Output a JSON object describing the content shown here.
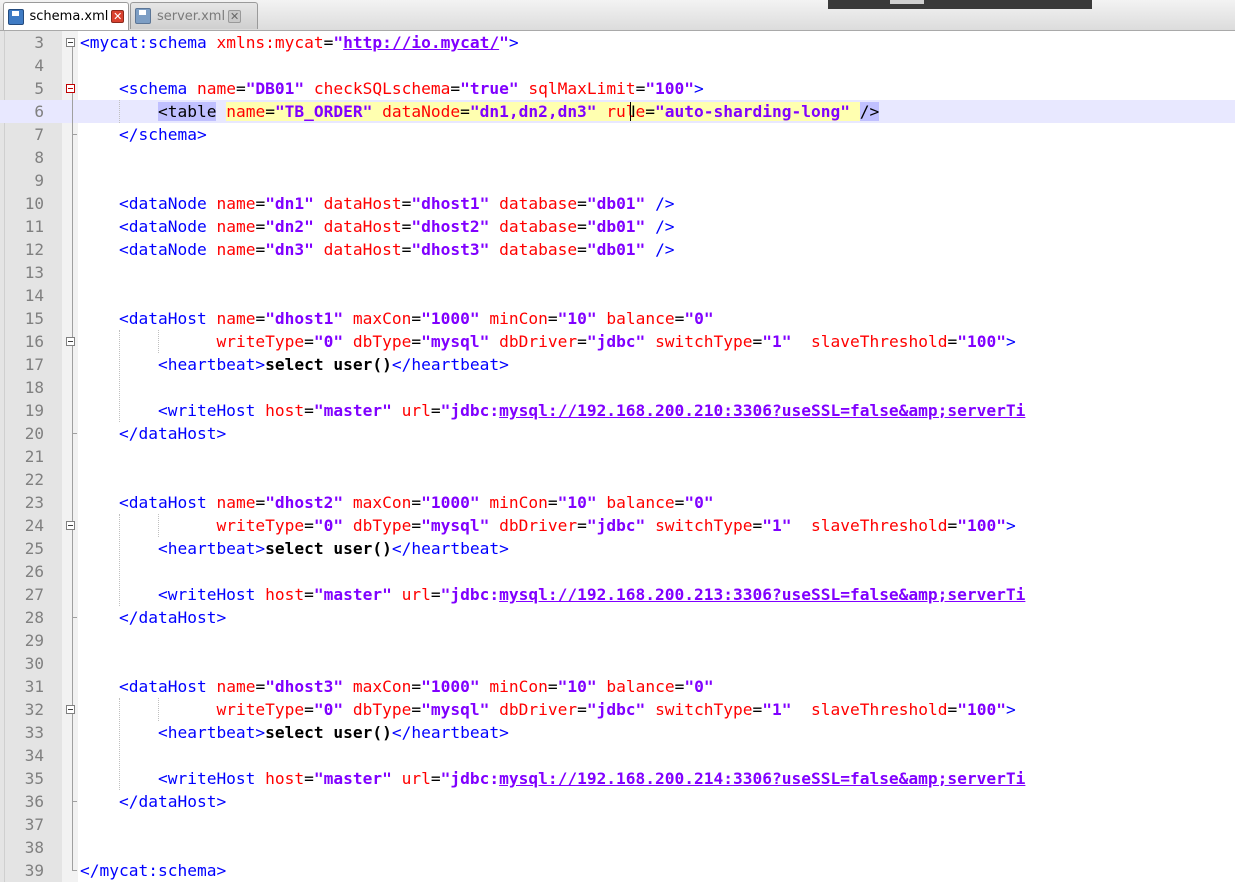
{
  "tabs": [
    {
      "label": "schema.xml",
      "active": true,
      "icon": "save-disk-icon"
    },
    {
      "label": "server.xml",
      "active": false,
      "icon": "save-disk-icon"
    }
  ],
  "tab_close_glyph": "✕",
  "editor": {
    "current_line": 6,
    "colors": {
      "tag": "#0000ff",
      "attribute": "#ff0000",
      "value": "#8000ff",
      "line_number": "#808080",
      "current_line_bg": "#e8e8ff"
    },
    "lines": [
      {
        "n": 3,
        "tokens": [
          [
            "tg",
            "<mycat:schema "
          ],
          [
            "at",
            "xmlns:mycat"
          ],
          [
            "eq",
            "="
          ],
          [
            "vl",
            "\""
          ],
          [
            "lk",
            "http://io.mycat/"
          ],
          [
            "vl",
            "\""
          ],
          [
            "tg",
            ">"
          ]
        ]
      },
      {
        "n": 4,
        "tokens": []
      },
      {
        "n": 5,
        "tokens": [
          [
            "tg",
            "    <schema "
          ],
          [
            "at",
            "name"
          ],
          [
            "eq",
            "="
          ],
          [
            "vl",
            "\"DB01\" "
          ],
          [
            "at",
            "checkSQLschema"
          ],
          [
            "eq",
            "="
          ],
          [
            "vl",
            "\"true\" "
          ],
          [
            "at",
            "sqlMaxLimit"
          ],
          [
            "eq",
            "="
          ],
          [
            "vl",
            "\"100\""
          ],
          [
            "tg",
            ">"
          ]
        ]
      },
      {
        "n": 6,
        "tokens": [
          [
            "tg",
            "        "
          ],
          [
            "tsel",
            "<table"
          ],
          [
            "tg",
            " "
          ],
          [
            "at hl",
            "name"
          ],
          [
            "eq hl",
            "="
          ],
          [
            "vl hl",
            "\"TB_ORDER\" "
          ],
          [
            "at hl",
            "dataNode"
          ],
          [
            "eq hl",
            "="
          ],
          [
            "vl hl",
            "\"dn1,dn2,dn3\" "
          ],
          [
            "at hl",
            "rule"
          ],
          [
            "eq hl",
            "="
          ],
          [
            "vl hl",
            "\"auto-sharding-long\" "
          ],
          [
            "tsel",
            "/>"
          ]
        ]
      },
      {
        "n": 7,
        "tokens": [
          [
            "tg",
            "    </schema>"
          ]
        ]
      },
      {
        "n": 8,
        "tokens": []
      },
      {
        "n": 9,
        "tokens": []
      },
      {
        "n": 10,
        "tokens": [
          [
            "tg",
            "    <dataNode "
          ],
          [
            "at",
            "name"
          ],
          [
            "eq",
            "="
          ],
          [
            "vl",
            "\"dn1\" "
          ],
          [
            "at",
            "dataHost"
          ],
          [
            "eq",
            "="
          ],
          [
            "vl",
            "\"dhost1\" "
          ],
          [
            "at",
            "database"
          ],
          [
            "eq",
            "="
          ],
          [
            "vl",
            "\"db01\" "
          ],
          [
            "tg",
            "/>"
          ]
        ]
      },
      {
        "n": 11,
        "tokens": [
          [
            "tg",
            "    <dataNode "
          ],
          [
            "at",
            "name"
          ],
          [
            "eq",
            "="
          ],
          [
            "vl",
            "\"dn2\" "
          ],
          [
            "at",
            "dataHost"
          ],
          [
            "eq",
            "="
          ],
          [
            "vl",
            "\"dhost2\" "
          ],
          [
            "at",
            "database"
          ],
          [
            "eq",
            "="
          ],
          [
            "vl",
            "\"db01\" "
          ],
          [
            "tg",
            "/>"
          ]
        ]
      },
      {
        "n": 12,
        "tokens": [
          [
            "tg",
            "    <dataNode "
          ],
          [
            "at",
            "name"
          ],
          [
            "eq",
            "="
          ],
          [
            "vl",
            "\"dn3\" "
          ],
          [
            "at",
            "dataHost"
          ],
          [
            "eq",
            "="
          ],
          [
            "vl",
            "\"dhost3\" "
          ],
          [
            "at",
            "database"
          ],
          [
            "eq",
            "="
          ],
          [
            "vl",
            "\"db01\" "
          ],
          [
            "tg",
            "/>"
          ]
        ]
      },
      {
        "n": 13,
        "tokens": []
      },
      {
        "n": 14,
        "tokens": []
      },
      {
        "n": 15,
        "tokens": [
          [
            "tg",
            "    <dataHost "
          ],
          [
            "at",
            "name"
          ],
          [
            "eq",
            "="
          ],
          [
            "vl",
            "\"dhost1\" "
          ],
          [
            "at",
            "maxCon"
          ],
          [
            "eq",
            "="
          ],
          [
            "vl",
            "\"1000\" "
          ],
          [
            "at",
            "minCon"
          ],
          [
            "eq",
            "="
          ],
          [
            "vl",
            "\"10\" "
          ],
          [
            "at",
            "balance"
          ],
          [
            "eq",
            "="
          ],
          [
            "vl",
            "\"0\""
          ]
        ]
      },
      {
        "n": 16,
        "tokens": [
          [
            "tg",
            "              "
          ],
          [
            "at",
            "writeType"
          ],
          [
            "eq",
            "="
          ],
          [
            "vl",
            "\"0\" "
          ],
          [
            "at",
            "dbType"
          ],
          [
            "eq",
            "="
          ],
          [
            "vl",
            "\"mysql\" "
          ],
          [
            "at",
            "dbDriver"
          ],
          [
            "eq",
            "="
          ],
          [
            "vl",
            "\"jdbc\" "
          ],
          [
            "at",
            "switchType"
          ],
          [
            "eq",
            "="
          ],
          [
            "vl",
            "\"1\"  "
          ],
          [
            "at",
            "slaveThreshold"
          ],
          [
            "eq",
            "="
          ],
          [
            "vl",
            "\"100\""
          ],
          [
            "tg",
            ">"
          ]
        ]
      },
      {
        "n": 17,
        "tokens": [
          [
            "tg",
            "        <heartbeat>"
          ],
          [
            "bd",
            "select user()"
          ],
          [
            "tg",
            "</heartbeat>"
          ]
        ]
      },
      {
        "n": 18,
        "tokens": []
      },
      {
        "n": 19,
        "tokens": [
          [
            "tg",
            "        <writeHost "
          ],
          [
            "at",
            "host"
          ],
          [
            "eq",
            "="
          ],
          [
            "vl",
            "\"master\" "
          ],
          [
            "at",
            "url"
          ],
          [
            "eq",
            "="
          ],
          [
            "vl",
            "\"jdbc:"
          ],
          [
            "lk",
            "mysql://192.168.200.210:3306?useSSL=false&amp;serverTi"
          ]
        ]
      },
      {
        "n": 20,
        "tokens": [
          [
            "tg",
            "    </dataHost>"
          ]
        ]
      },
      {
        "n": 21,
        "tokens": []
      },
      {
        "n": 22,
        "tokens": []
      },
      {
        "n": 23,
        "tokens": [
          [
            "tg",
            "    <dataHost "
          ],
          [
            "at",
            "name"
          ],
          [
            "eq",
            "="
          ],
          [
            "vl",
            "\"dhost2\" "
          ],
          [
            "at",
            "maxCon"
          ],
          [
            "eq",
            "="
          ],
          [
            "vl",
            "\"1000\" "
          ],
          [
            "at",
            "minCon"
          ],
          [
            "eq",
            "="
          ],
          [
            "vl",
            "\"10\" "
          ],
          [
            "at",
            "balance"
          ],
          [
            "eq",
            "="
          ],
          [
            "vl",
            "\"0\""
          ]
        ]
      },
      {
        "n": 24,
        "tokens": [
          [
            "tg",
            "              "
          ],
          [
            "at",
            "writeType"
          ],
          [
            "eq",
            "="
          ],
          [
            "vl",
            "\"0\" "
          ],
          [
            "at",
            "dbType"
          ],
          [
            "eq",
            "="
          ],
          [
            "vl",
            "\"mysql\" "
          ],
          [
            "at",
            "dbDriver"
          ],
          [
            "eq",
            "="
          ],
          [
            "vl",
            "\"jdbc\" "
          ],
          [
            "at",
            "switchType"
          ],
          [
            "eq",
            "="
          ],
          [
            "vl",
            "\"1\"  "
          ],
          [
            "at",
            "slaveThreshold"
          ],
          [
            "eq",
            "="
          ],
          [
            "vl",
            "\"100\""
          ],
          [
            "tg",
            ">"
          ]
        ]
      },
      {
        "n": 25,
        "tokens": [
          [
            "tg",
            "        <heartbeat>"
          ],
          [
            "bd",
            "select user()"
          ],
          [
            "tg",
            "</heartbeat>"
          ]
        ]
      },
      {
        "n": 26,
        "tokens": []
      },
      {
        "n": 27,
        "tokens": [
          [
            "tg",
            "        <writeHost "
          ],
          [
            "at",
            "host"
          ],
          [
            "eq",
            "="
          ],
          [
            "vl",
            "\"master\" "
          ],
          [
            "at",
            "url"
          ],
          [
            "eq",
            "="
          ],
          [
            "vl",
            "\"jdbc:"
          ],
          [
            "lk",
            "mysql://192.168.200.213:3306?useSSL=false&amp;serverTi"
          ]
        ]
      },
      {
        "n": 28,
        "tokens": [
          [
            "tg",
            "    </dataHost>"
          ]
        ]
      },
      {
        "n": 29,
        "tokens": []
      },
      {
        "n": 30,
        "tokens": []
      },
      {
        "n": 31,
        "tokens": [
          [
            "tg",
            "    <dataHost "
          ],
          [
            "at",
            "name"
          ],
          [
            "eq",
            "="
          ],
          [
            "vl",
            "\"dhost3\" "
          ],
          [
            "at",
            "maxCon"
          ],
          [
            "eq",
            "="
          ],
          [
            "vl",
            "\"1000\" "
          ],
          [
            "at",
            "minCon"
          ],
          [
            "eq",
            "="
          ],
          [
            "vl",
            "\"10\" "
          ],
          [
            "at",
            "balance"
          ],
          [
            "eq",
            "="
          ],
          [
            "vl",
            "\"0\""
          ]
        ]
      },
      {
        "n": 32,
        "tokens": [
          [
            "tg",
            "              "
          ],
          [
            "at",
            "writeType"
          ],
          [
            "eq",
            "="
          ],
          [
            "vl",
            "\"0\" "
          ],
          [
            "at",
            "dbType"
          ],
          [
            "eq",
            "="
          ],
          [
            "vl",
            "\"mysql\" "
          ],
          [
            "at",
            "dbDriver"
          ],
          [
            "eq",
            "="
          ],
          [
            "vl",
            "\"jdbc\" "
          ],
          [
            "at",
            "switchType"
          ],
          [
            "eq",
            "="
          ],
          [
            "vl",
            "\"1\"  "
          ],
          [
            "at",
            "slaveThreshold"
          ],
          [
            "eq",
            "="
          ],
          [
            "vl",
            "\"100\""
          ],
          [
            "tg",
            ">"
          ]
        ]
      },
      {
        "n": 33,
        "tokens": [
          [
            "tg",
            "        <heartbeat>"
          ],
          [
            "bd",
            "select user()"
          ],
          [
            "tg",
            "</heartbeat>"
          ]
        ]
      },
      {
        "n": 34,
        "tokens": []
      },
      {
        "n": 35,
        "tokens": [
          [
            "tg",
            "        <writeHost "
          ],
          [
            "at",
            "host"
          ],
          [
            "eq",
            "="
          ],
          [
            "vl",
            "\"master\" "
          ],
          [
            "at",
            "url"
          ],
          [
            "eq",
            "="
          ],
          [
            "vl",
            "\"jdbc:"
          ],
          [
            "lk",
            "mysql://192.168.200.214:3306?useSSL=false&amp;serverTi"
          ]
        ]
      },
      {
        "n": 36,
        "tokens": [
          [
            "tg",
            "    </dataHost>"
          ]
        ]
      },
      {
        "n": 37,
        "tokens": []
      },
      {
        "n": 38,
        "tokens": []
      },
      {
        "n": 39,
        "tokens": [
          [
            "tg",
            "</mycat:schema>"
          ]
        ]
      }
    ]
  }
}
